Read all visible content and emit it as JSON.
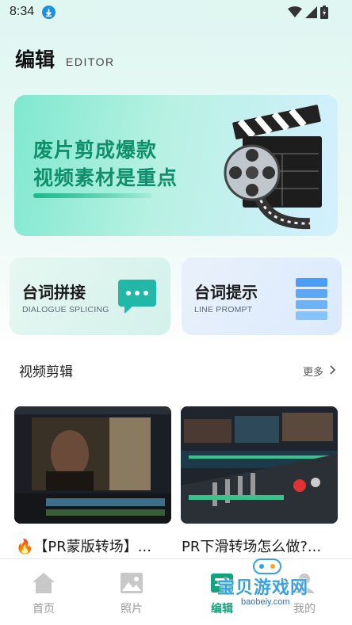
{
  "status_bar": {
    "time": "8:34"
  },
  "header": {
    "title": "编辑",
    "subtitle": "EDITOR"
  },
  "banner": {
    "line1": "废片剪成爆款",
    "line2": "视频素材是重点"
  },
  "features": [
    {
      "title": "台词拼接",
      "subtitle": "DIALOGUE SPLICING"
    },
    {
      "title": "台词提示",
      "subtitle": "LINE PROMPT"
    }
  ],
  "section": {
    "title": "视频剪辑",
    "more": "更多"
  },
  "videos": [
    {
      "caption": "🔥【PR蒙版转场】..."
    },
    {
      "caption": "PR下滑转场怎么做?..."
    }
  ],
  "bottom_nav": {
    "items": [
      {
        "label": "首页",
        "icon": "home-icon"
      },
      {
        "label": "照片",
        "icon": "image-icon"
      },
      {
        "label": "编辑",
        "icon": "edit-icon"
      },
      {
        "label": "我的",
        "icon": "user-icon"
      }
    ],
    "active": "编辑"
  },
  "watermark": {
    "text": "宝贝游戏网",
    "url": "baobeiy.com"
  },
  "colors": {
    "accent": "#12a37c",
    "banner_text": "#0f8f6a",
    "line_prompt_icon": "#4a9ef5",
    "dialogue_icon": "#22b8a8"
  }
}
